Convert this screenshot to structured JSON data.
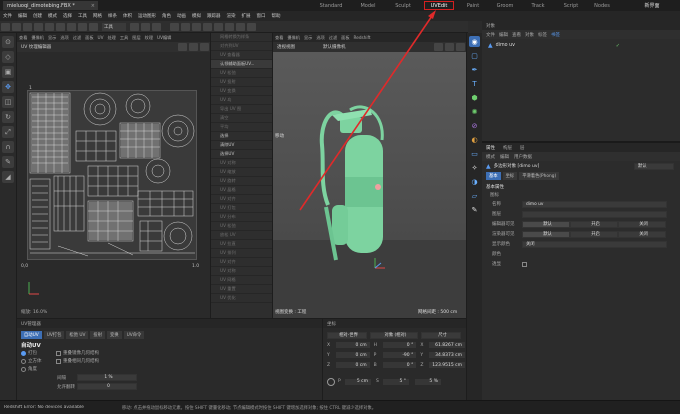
{
  "titlebar": {
    "file_tab": "mieluoqi_dimotebing.FBX *",
    "layouts": [
      "Standard",
      "Model",
      "Sculpt",
      "UVEdit",
      "Paint",
      "Groom",
      "Track",
      "Script",
      "Nodes"
    ],
    "active_layout": "UVEdit",
    "new_scene": "新界面"
  },
  "menubar": [
    "文件",
    "编辑",
    "创建",
    "模式",
    "选择",
    "工具",
    "网格",
    "样条",
    "体积",
    "运动图形",
    "角色",
    "动画",
    "模拟",
    "跟踪器",
    "渲染",
    "扩展",
    "窗口",
    "帮助"
  ],
  "toolbar": {
    "mode_label": "工具"
  },
  "uv_editor": {
    "menu": [
      "查看",
      "摄像机",
      "显示",
      "选项",
      "过滤",
      "面板",
      "UV",
      "处理",
      "工具",
      "图层",
      "纹理",
      "UV编辑"
    ],
    "header": "UV 纹理编辑器",
    "axis_zero": "0",
    "axis_one_x": "1.0",
    "axis_one_y": "1",
    "axis_zero_y": "0,0",
    "zoom": "缩放: 16.0%"
  },
  "mid_panel": {
    "items": [
      "网格转换为样条",
      "对齐到UV",
      "UV 查看器",
      "UV...",
      "UV 松弛",
      "UV 投射",
      "UV 变换",
      "UV 岛",
      "导出 UV 图",
      "清空",
      "平均",
      "UV 镜像",
      "UV 翻转",
      "UV 对称",
      "UV 对称",
      "UV 缩放",
      "UV 旋转",
      "UV 晶格",
      "UV 对齐",
      "UV 打包",
      "UV 分布",
      "UV 松弛",
      "放松 UV",
      "UV 拉直",
      "UV 排列",
      "UV 对齐",
      "UV 对称",
      "UV 网格",
      "UV 重置",
      "UV 优化"
    ],
    "active_title": "认领辅助面板UV...",
    "sections": [
      "选择",
      "清除UV",
      "选择UV"
    ]
  },
  "viewport": {
    "menu": [
      "查看",
      "摄像机",
      "显示",
      "选项",
      "过滤",
      "面板",
      "Redshift"
    ],
    "label": "透视视图",
    "camera": "默认摄像机",
    "hud_bottom": "网格间距 : 500 cm",
    "hud_left": "视图变换 : 工程",
    "move_label": "移动"
  },
  "objects": {
    "header": "对象",
    "menu": [
      "文件",
      "编辑",
      "查看",
      "对象",
      "标签",
      "书签"
    ],
    "item": "dimo uv"
  },
  "attributes": {
    "header": "属性",
    "tabs_top": [
      "属性",
      "构层",
      "层"
    ],
    "menu": [
      "模式",
      "编辑",
      "用户数据"
    ],
    "object_line": "多边形对象 [dimo uv]",
    "dropdown": "默认",
    "sub_tabs": [
      "基本",
      "坐标",
      "平滑着色(Phong)"
    ],
    "section": "基本属性",
    "group": "图标",
    "fields": [
      {
        "label": "名称",
        "value": "dimo uv"
      },
      {
        "label": "图层",
        "value": ""
      },
      {
        "label": "编辑器可见",
        "value": "默认",
        "opt1": "开启",
        "opt2": "关闭"
      },
      {
        "label": "渲染器可见",
        "value": "默认",
        "opt1": "开启",
        "opt2": "关闭"
      },
      {
        "label": "显示颜色",
        "value": "关闭"
      },
      {
        "label": "颜色",
        "value": ""
      },
      {
        "label": "透显",
        "value": ""
      }
    ]
  },
  "uv_manager": {
    "title": "UV管理器",
    "tabs": [
      "自动UV",
      "UV打包",
      "松弛 UV",
      "投射",
      "变换",
      "UV命令"
    ],
    "section": "自动UV",
    "options": [
      {
        "label": "打包",
        "on": true
      },
      {
        "label": "立方体",
        "on": false
      },
      {
        "label": "角度",
        "on": false
      }
    ],
    "checks": [
      "重叠镜像几何结构",
      "重叠相同几何结构"
    ],
    "spacing_label": "间隔",
    "spacing_value": "1 %",
    "realign_label": "允许翻转",
    "realign_value": "0"
  },
  "coordinates": {
    "title": "坐标",
    "modes": [
      "相对-世界",
      "对象 (相对)",
      "尺寸"
    ],
    "rows": [
      {
        "axis": "X",
        "pos": "0 cm",
        "rot_axis": "H",
        "rot": "0 °",
        "size_axis": "X",
        "size": "61.8267 cm"
      },
      {
        "axis": "Y",
        "pos": "0 cm",
        "rot_axis": "P",
        "rot": "-90 °",
        "size_axis": "Y",
        "size": "34.8373 cm"
      },
      {
        "axis": "Z",
        "pos": "0 cm",
        "rot_axis": "B",
        "rot": "0 °",
        "size_axis": "Z",
        "size": "123.9515 cm"
      }
    ],
    "footer": [
      {
        "label": "P",
        "value": "5 cm"
      },
      {
        "label": "S",
        "value": "5 °"
      },
      {
        "label": "",
        "value": "5 %"
      }
    ],
    "apply": "应用"
  },
  "statusbar": {
    "left": "Redshift Error: No devices available",
    "hint": "移动: 点击并拖动鼠标移动元素。按住 SHIFT 键量化移动; 节点编辑模式时按住 SHIFT 键增加选择对象; 按住 CTRL 键减少选择对象。"
  },
  "colors": {
    "accent": "#3d6fb5",
    "highlight_box": "#d32020",
    "model": "#7dd3a0",
    "arrow": "#e02a2a"
  }
}
